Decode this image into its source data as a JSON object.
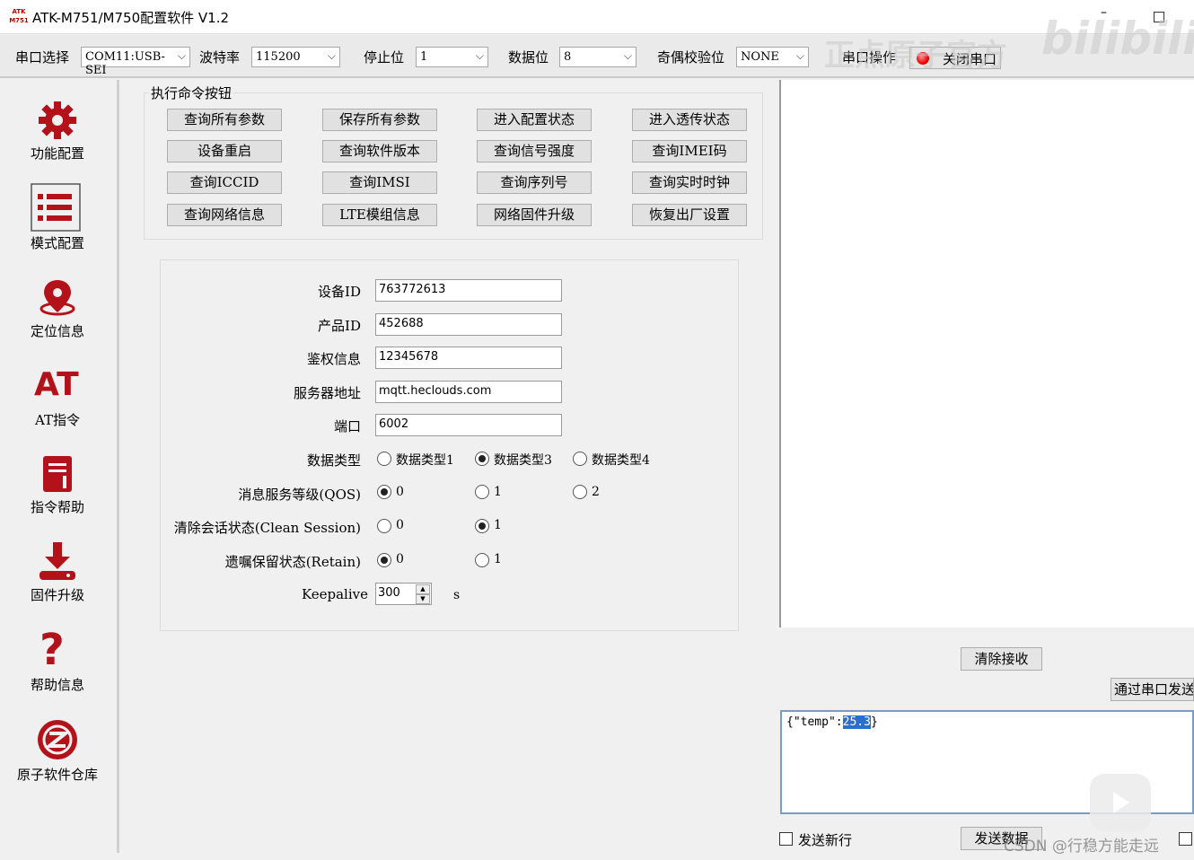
{
  "titlebar": {
    "logo_text": "ATK M751",
    "title": "ATK-M751/M750配置软件 V1.2",
    "minimize": "–"
  },
  "toolbar": {
    "port_label": "串口选择",
    "port_value": "COM11:USB-SEI",
    "baud_label": "波特率",
    "baud_value": "115200",
    "stop_label": "停止位",
    "stop_value": "1",
    "data_label": "数据位",
    "data_value": "8",
    "parity_label": "奇偶校验位",
    "parity_value": "NONE",
    "serial_op_label": "串口操作",
    "close_port_label": "关闭串口"
  },
  "watermark": {
    "text1": "正点原子官方",
    "text2": "bilibili",
    "csdn": "CSDN @行稳方能走远"
  },
  "sidebar": {
    "items": [
      {
        "label": "功能配置",
        "icon": "gear-icon"
      },
      {
        "label": "模式配置",
        "icon": "list-icon"
      },
      {
        "label": "定位信息",
        "icon": "location-pin-icon"
      },
      {
        "label": "AT指令",
        "icon": "at-icon",
        "glyph": "AT"
      },
      {
        "label": "指令帮助",
        "icon": "book-icon"
      },
      {
        "label": "固件升级",
        "icon": "download-icon"
      },
      {
        "label": "帮助信息",
        "icon": "question-icon",
        "glyph": "?"
      },
      {
        "label": "原子软件仓库",
        "icon": "alientek-logo-icon"
      }
    ]
  },
  "commands": {
    "group_title": "执行命令按钮",
    "buttons": [
      "查询所有参数",
      "保存所有参数",
      "进入配置状态",
      "进入透传状态",
      "设备重启",
      "查询软件版本",
      "查询信号强度",
      "查询IMEI码",
      "查询ICCID",
      "查询IMSI",
      "查询序列号",
      "查询实时时钟",
      "查询网络信息",
      "LTE模组信息",
      "网络固件升级",
      "恢复出厂设置"
    ]
  },
  "params": {
    "device_id_label": "设备ID",
    "device_id": "763772613",
    "product_id_label": "产品ID",
    "product_id": "452688",
    "auth_label": "鉴权信息",
    "auth": "12345678",
    "server_label": "服务器地址",
    "server": "mqtt.heclouds.com",
    "port_label": "端口",
    "port": "6002",
    "data_type_label": "数据类型",
    "data_type_options": [
      "数据类型1",
      "数据类型3",
      "数据类型4"
    ],
    "data_type_selected": 1,
    "qos_label": "消息服务等级(QOS)",
    "qos_options": [
      "0",
      "1",
      "2"
    ],
    "qos_selected": 0,
    "clean_label": "清除会话状态(Clean Session)",
    "clean_options": [
      "0",
      "1"
    ],
    "clean_selected": 1,
    "retain_label": "遗嘱保留状态(Retain)",
    "retain_options": [
      "0",
      "1"
    ],
    "retain_selected": 0,
    "keepalive_label": "Keepalive",
    "keepalive": "300",
    "keepalive_unit": "s"
  },
  "right": {
    "clear_recv": "清除接收",
    "send_via_serial": "通过串口发送",
    "send_text_prefix": "{\"temp\":",
    "send_text_selected": "25.3",
    "send_text_suffix": "}",
    "newline_label": "发送新行",
    "send_button": "发送数据"
  }
}
